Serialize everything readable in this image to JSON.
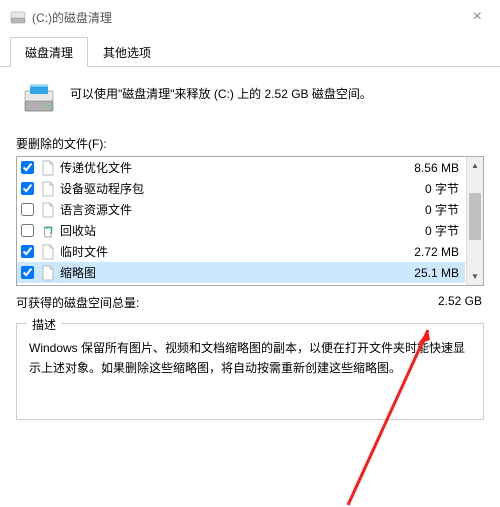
{
  "window": {
    "title": "(C:)的磁盘清理"
  },
  "tabs": {
    "disk_cleanup": "磁盘清理",
    "other_options": "其他选项"
  },
  "intro": {
    "text": "可以使用\"磁盘清理\"来释放  (C:) 上的 2.52 GB 磁盘空间。"
  },
  "files_section_label": "要删除的文件(F):",
  "files": [
    {
      "checked": true,
      "icon": "file",
      "name": "传递优化文件",
      "size": "8.56 MB"
    },
    {
      "checked": true,
      "icon": "file",
      "name": "设备驱动程序包",
      "size": "0 字节"
    },
    {
      "checked": false,
      "icon": "file",
      "name": "语言资源文件",
      "size": "0 字节"
    },
    {
      "checked": false,
      "icon": "recycle",
      "name": "回收站",
      "size": "0 字节"
    },
    {
      "checked": true,
      "icon": "file",
      "name": "临时文件",
      "size": "2.72 MB"
    },
    {
      "checked": true,
      "icon": "file",
      "name": "缩略图",
      "size": "25.1 MB",
      "selected": true
    }
  ],
  "total": {
    "label": "可获得的磁盘空间总量:",
    "value": "2.52 GB"
  },
  "description": {
    "legend": "描述",
    "text": "Windows 保留所有图片、视频和文档缩略图的副本，以便在打开文件夹时能快速显示上述对象。如果删除这些缩略图，将自动按需重新创建这些缩略图。"
  }
}
